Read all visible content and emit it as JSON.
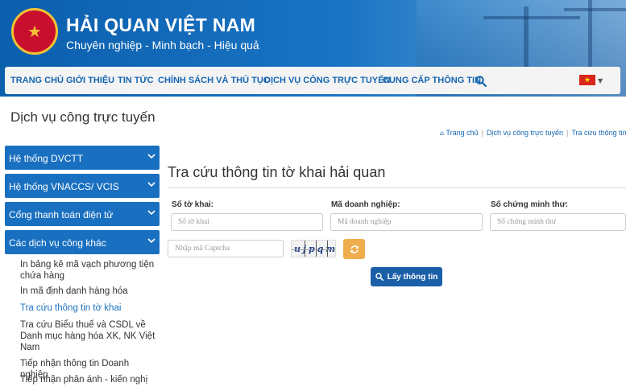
{
  "header": {
    "title": "HẢI QUAN VIỆT NAM",
    "tagline": "Chuyên nghiệp - Minh bạch - Hiệu quả",
    "logo_icon": "vietnam-customs-emblem"
  },
  "nav": {
    "items": [
      "TRANG CHỦ",
      "GIỚI THIỆU",
      "TIN TỨC",
      "CHÍNH SÁCH VÀ THỦ TỤC",
      "DỊCH VỤ CÔNG TRỰC TUYẾN",
      "CUNG CẤP THÔNG TIN"
    ],
    "search_icon": "search-icon",
    "language_flag": "vietnam-flag-icon"
  },
  "page": {
    "heading": "Dịch vụ công trực tuyến",
    "breadcrumb": [
      "Trang chủ",
      "Dịch vụ công trực tuyến",
      "Tra cứu thông tin tờ"
    ]
  },
  "sidebar": {
    "groups": [
      "Hệ thống DVCTT",
      "Hệ thống VNACCS/ VCIS",
      "Cổng thanh toán điện tử",
      "Các dịch vụ công khác"
    ],
    "sub_items": [
      "In bảng kê mã vạch phương tiện chứa hàng",
      "In mã định danh hàng hóa",
      "Tra cứu thông tin tờ khai",
      "Tra cứu Biểu thuế và CSDL về Danh mục hàng hóa XK, NK Việt Nam",
      "Tiếp nhận thông tin Doanh nghiệp",
      "Tiếp nhận phản ánh - kiến nghị"
    ],
    "active_sub_item": "Tra cứu thông tin tờ khai"
  },
  "form": {
    "title": "Tra cứu thông tin tờ khai hải quan",
    "fields": [
      {
        "label": "Số tờ khai:",
        "placeholder": "Số tờ khai",
        "value": ""
      },
      {
        "label": "Mã doanh nghiệp:",
        "placeholder": "Mã doanh nghiệp",
        "value": ""
      },
      {
        "label": "Số chứng minh thư:",
        "placeholder": "Số chứng minh thư",
        "value": ""
      }
    ],
    "captcha_placeholder": "Nhập mã Captcha",
    "captcha_text": "ujpqm",
    "submit_label": "Lấy thông tin"
  },
  "colors": {
    "brand_blue": "#1a70c0",
    "refresh_orange": "#f0ad4e",
    "submit_blue": "#1a5fa8"
  }
}
